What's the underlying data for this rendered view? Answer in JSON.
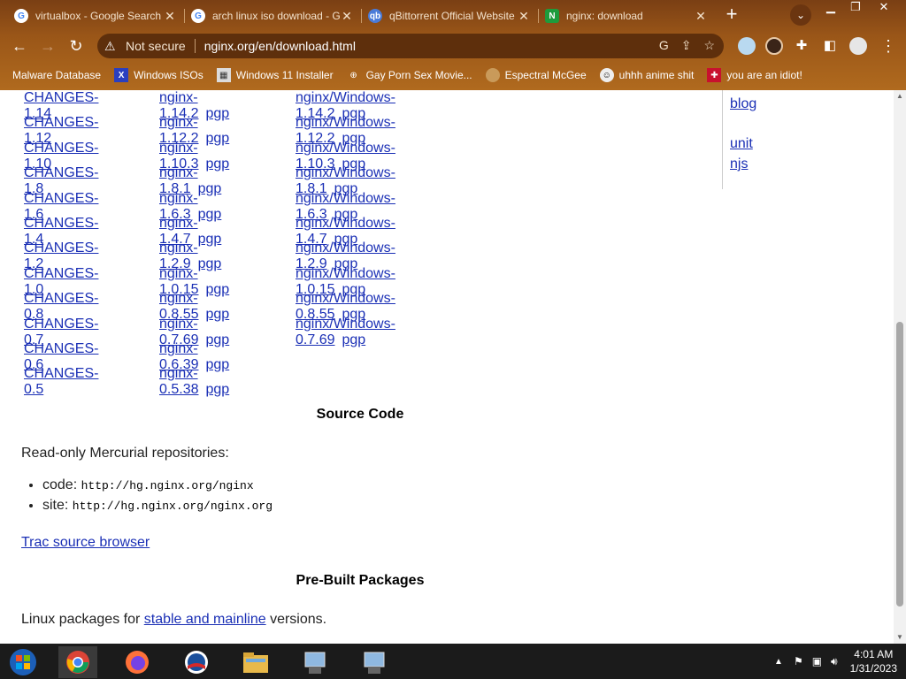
{
  "tabs": [
    {
      "title": "virtualbox - Google Search",
      "favicon": "google-icon"
    },
    {
      "title": "arch linux iso download - Google Search",
      "favicon": "google-icon"
    },
    {
      "title": "qBittorrent Official Website",
      "favicon": "qbittorrent-icon"
    },
    {
      "title": "nginx: download",
      "favicon": "nginx-icon",
      "active": true
    }
  ],
  "toolbar": {
    "security_label": "Not secure",
    "url": "nginx.org/en/download.html"
  },
  "bookmarks": [
    {
      "label": "Malware Database",
      "icon": "malware-icon"
    },
    {
      "label": "Windows ISOs",
      "icon": "x-icon"
    },
    {
      "label": "Windows 11 Installer",
      "icon": "installer-icon"
    },
    {
      "label": "Gay Porn Sex Movie...",
      "icon": "globe-icon"
    },
    {
      "label": "Espectral McGee",
      "icon": "avatar-icon"
    },
    {
      "label": "uhhh anime shit",
      "icon": "anime-icon"
    },
    {
      "label": "you are an idiot!",
      "icon": "flag-icon"
    }
  ],
  "releases": [
    {
      "changes": "CHANGES-1.14",
      "linux": "nginx-1.14.2",
      "windows": "nginx/Windows-1.14.2"
    },
    {
      "changes": "CHANGES-1.12",
      "linux": "nginx-1.12.2",
      "windows": "nginx/Windows-1.12.2"
    },
    {
      "changes": "CHANGES-1.10",
      "linux": "nginx-1.10.3",
      "windows": "nginx/Windows-1.10.3"
    },
    {
      "changes": "CHANGES-1.8",
      "linux": "nginx-1.8.1",
      "windows": "nginx/Windows-1.8.1"
    },
    {
      "changes": "CHANGES-1.6",
      "linux": "nginx-1.6.3",
      "windows": "nginx/Windows-1.6.3"
    },
    {
      "changes": "CHANGES-1.4",
      "linux": "nginx-1.4.7",
      "windows": "nginx/Windows-1.4.7"
    },
    {
      "changes": "CHANGES-1.2",
      "linux": "nginx-1.2.9",
      "windows": "nginx/Windows-1.2.9"
    },
    {
      "changes": "CHANGES-1.0",
      "linux": "nginx-1.0.15",
      "windows": "nginx/Windows-1.0.15"
    },
    {
      "changes": "CHANGES-0.8",
      "linux": "nginx-0.8.55",
      "windows": "nginx/Windows-0.8.55"
    },
    {
      "changes": "CHANGES-0.7",
      "linux": "nginx-0.7.69",
      "windows": "nginx/Windows-0.7.69"
    },
    {
      "changes": "CHANGES-0.6",
      "linux": "nginx-0.6.39",
      "windows": ""
    },
    {
      "changes": "CHANGES-0.5",
      "linux": "nginx-0.5.38",
      "windows": ""
    }
  ],
  "pgp_label": "pgp",
  "sidebar": {
    "links": [
      "blog",
      "unit",
      "njs"
    ]
  },
  "source": {
    "heading": "Source Code",
    "intro": "Read-only Mercurial repositories:",
    "repos": [
      {
        "label": "code:",
        "url": "http://hg.nginx.org/nginx"
      },
      {
        "label": "site:",
        "url": "http://hg.nginx.org/nginx.org"
      }
    ],
    "trac_link": "Trac source browser"
  },
  "packages": {
    "heading": "Pre-Built Packages",
    "text_before": "Linux packages for ",
    "link": "stable and mainline",
    "text_after": " versions."
  },
  "taskbar": {
    "time": "4:01 AM",
    "date": "1/31/2023"
  },
  "colors": {
    "link": "#1a2fb5",
    "chrome_theme": "#9a5618",
    "taskbar": "#1b1b1b"
  }
}
